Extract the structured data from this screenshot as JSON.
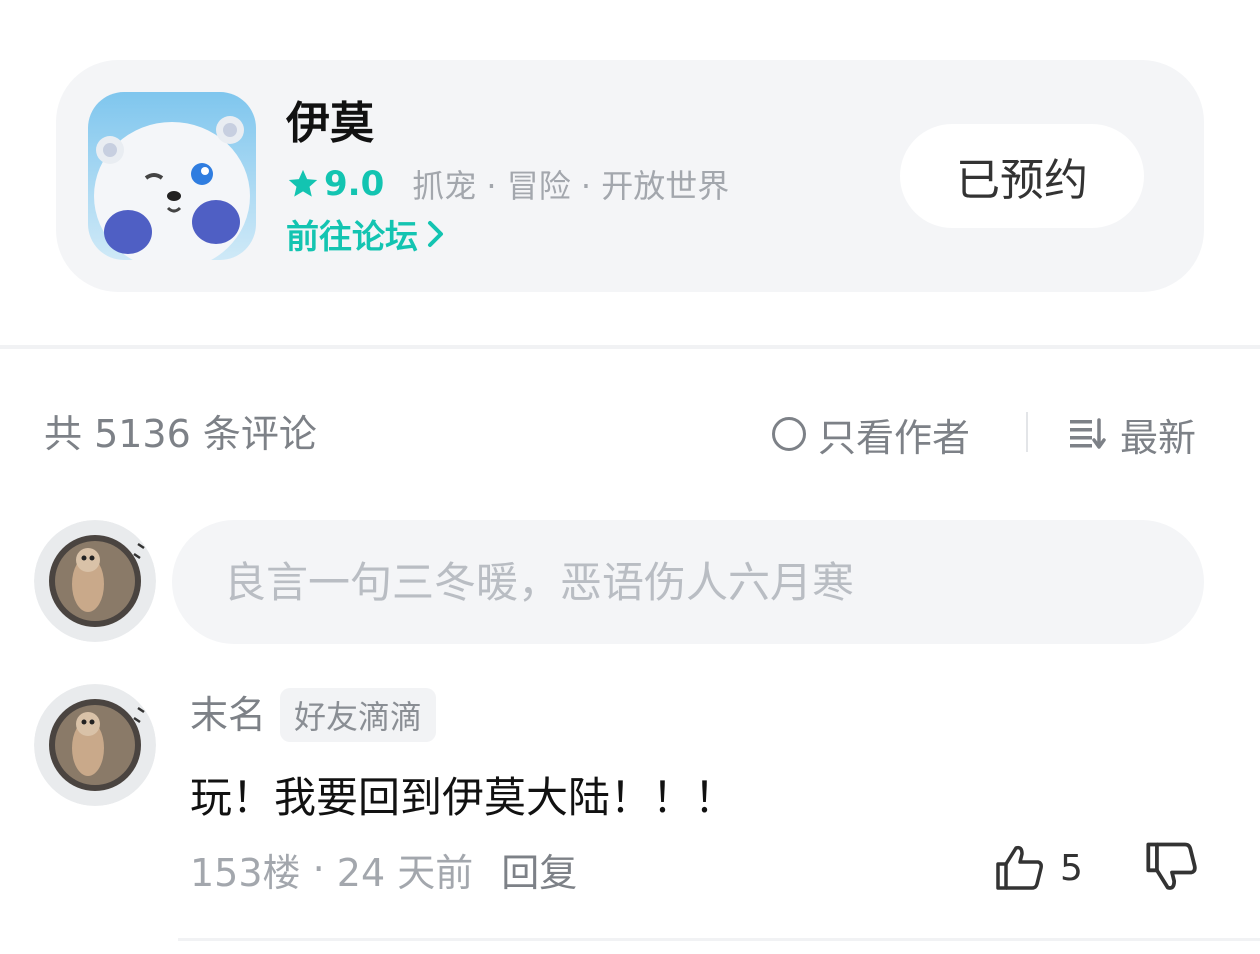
{
  "game": {
    "title": "伊莫",
    "rating": "9.0",
    "tags": "抓宠 · 冒险 · 开放世界",
    "forum_link": "前往论坛",
    "reserve_label": "已预约",
    "accent_color": "#13c4b1"
  },
  "comments_header": {
    "count_label": "共 5136 条评论",
    "author_only_label": "只看作者",
    "sort_label": "最新"
  },
  "composer": {
    "placeholder": "良言一句三冬暖，恶语伤人六月寒"
  },
  "comments": [
    {
      "author": "末名",
      "badge": "好友滴滴",
      "text": "玩！我要回到伊莫大陆！！！",
      "floor": "153楼",
      "time": "24 天前",
      "reply_label": "回复",
      "likes": "5"
    }
  ],
  "icons": [
    "star-icon",
    "chevron-right-icon",
    "radio-circle-icon",
    "sort-icon",
    "thumbs-up-icon",
    "thumbs-down-icon"
  ]
}
